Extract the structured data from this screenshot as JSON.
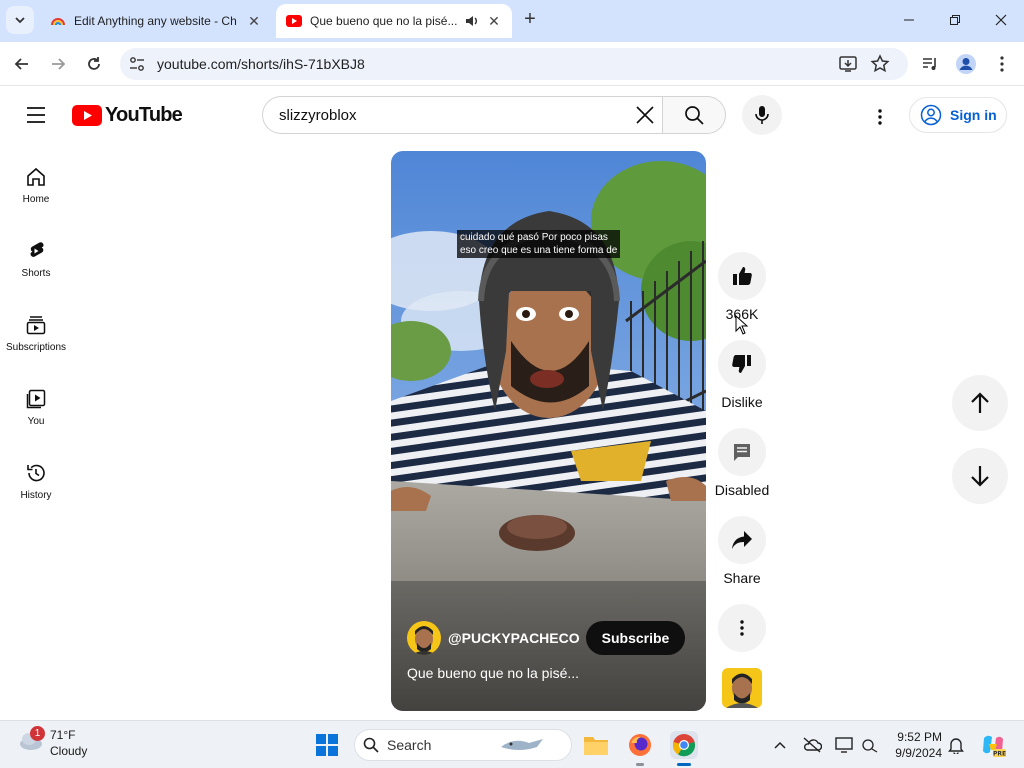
{
  "browser": {
    "tabs": [
      {
        "title": "Edit Anything any website - Ch",
        "active": false
      },
      {
        "title": "Que bueno que no la pisé...",
        "active": true
      }
    ],
    "address": "youtube.com/shorts/ihS-71bXBJ8"
  },
  "youtube": {
    "logo_text": "YouTube",
    "search_query": "slizzyroblox",
    "sign_in_label": "Sign in",
    "guide": [
      {
        "label": "Home",
        "icon": "home-icon"
      },
      {
        "label": "Shorts",
        "icon": "shorts-icon"
      },
      {
        "label": "Subscriptions",
        "icon": "subscriptions-icon"
      },
      {
        "label": "You",
        "icon": "you-icon"
      },
      {
        "label": "History",
        "icon": "history-icon"
      }
    ],
    "short": {
      "caption_line1": "cuidado qué pasó Por poco pisas",
      "caption_line2": "eso creo que es una tiene forma de",
      "channel": "@PUCKYPACHECO",
      "subscribe_label": "Subscribe",
      "title": "Que bueno que no la pisé..."
    },
    "actions": {
      "like_count": "366K",
      "dislike_label": "Dislike",
      "comments_label": "Disabled",
      "share_label": "Share"
    },
    "colors": {
      "brand_red": "#ff0000",
      "link_blue": "#065fd4"
    }
  },
  "taskbar": {
    "weather_temp": "71°F",
    "weather_desc": "Cloudy",
    "weather_badge": "1",
    "search_label": "Search",
    "time": "9:52 PM",
    "date": "9/9/2024"
  }
}
